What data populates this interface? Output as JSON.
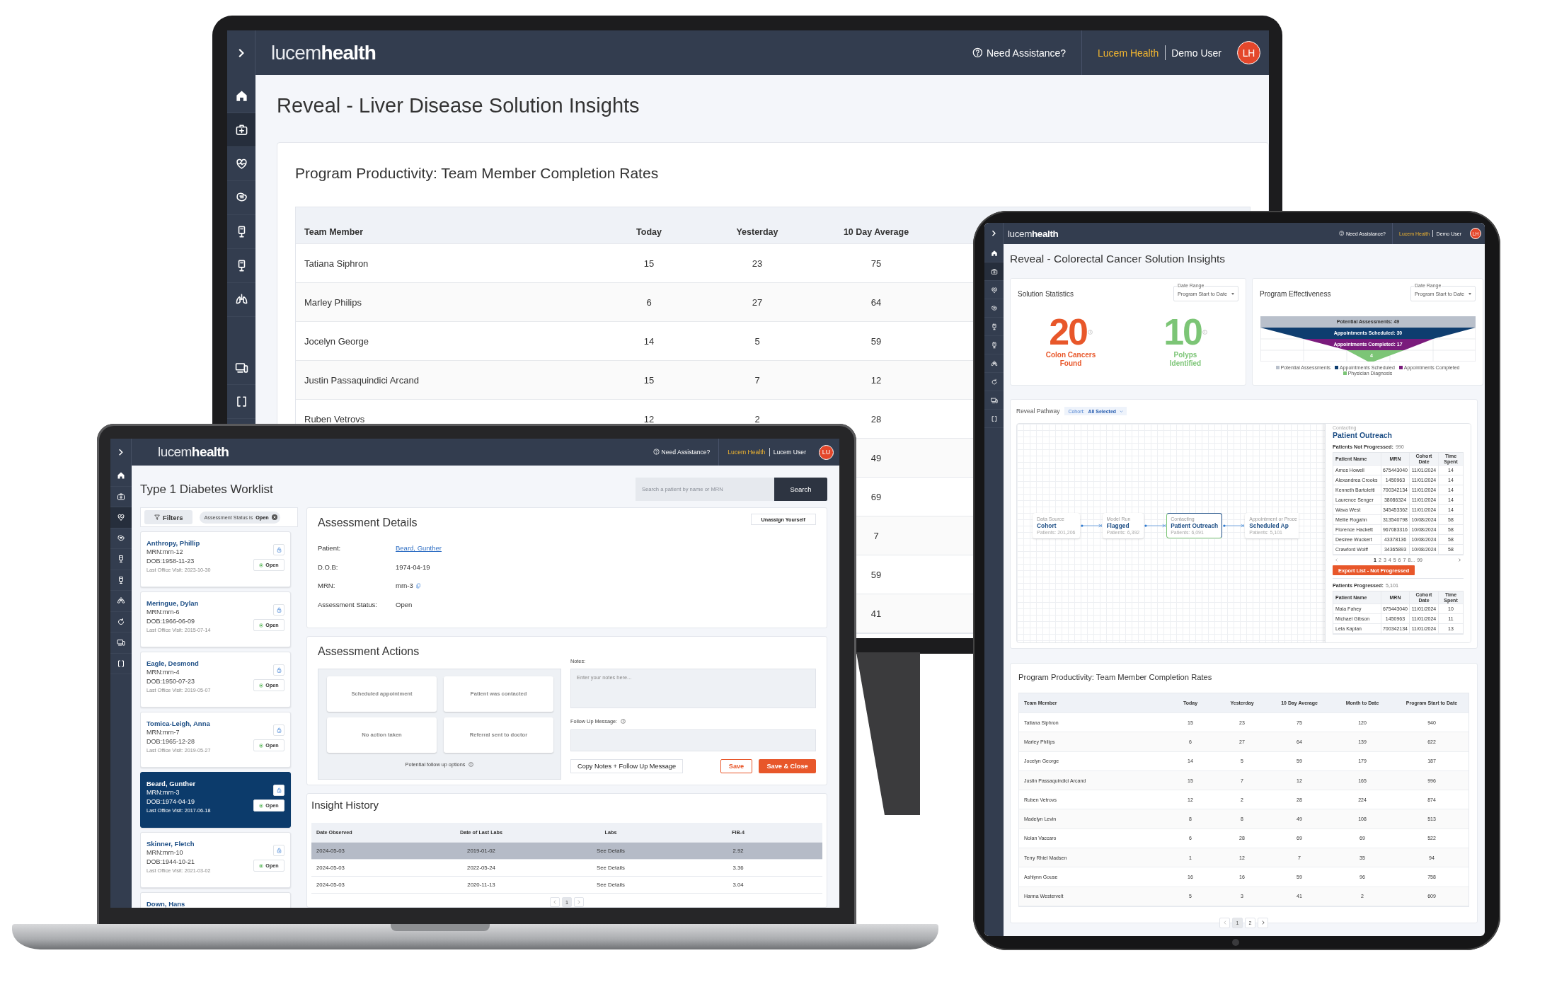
{
  "monitor": {
    "header": {
      "logo": "lucem**health**",
      "help": "Need Assistance?",
      "organization": "Lucem Health",
      "user": "Demo User",
      "avatar": "LH"
    },
    "sidebar": [
      {
        "kind": "home",
        "selected": false
      },
      {
        "kind": "medkit",
        "selected": true
      },
      {
        "kind": "heart",
        "selected": false
      },
      {
        "kind": "organ",
        "selected": false
      },
      {
        "kind": "kiosk",
        "selected": false
      },
      {
        "kind": "kiosk",
        "selected": false
      },
      {
        "kind": "lungs",
        "selected": false
      },
      {
        "kind": "blank"
      },
      {
        "kind": "devices",
        "selected": false
      },
      {
        "kind": "brackets",
        "selected": false
      }
    ],
    "title": "Reveal - Liver Disease Solution Insights",
    "productivity": {
      "title": "Program Productivity: Team Member Completion Rates",
      "columns": [
        "Team Member",
        "Today",
        "Yesterday",
        "10 Day Average"
      ],
      "rows": [
        {
          "name": "Tatiana Siphron",
          "today": "15",
          "yesterday": "23",
          "average": "75"
        },
        {
          "name": "Marley Philips",
          "today": "6",
          "yesterday": "27",
          "average": "64"
        },
        {
          "name": "Jocelyn George",
          "today": "14",
          "yesterday": "5",
          "average": "59"
        },
        {
          "name": "Justin Passaquindici Arcand",
          "today": "15",
          "yesterday": "7",
          "average": "12"
        },
        {
          "name": "Ruben Vetrovs",
          "today": "12",
          "yesterday": "2",
          "average": "28"
        },
        {
          "average": "49"
        },
        {
          "average": "69"
        },
        {
          "average": "7"
        },
        {
          "average": "59"
        },
        {
          "average": "41"
        }
      ]
    }
  },
  "laptop": {
    "header": {
      "logo": "lucem**health**",
      "help": "Need Assistance?",
      "organization": "Lucem Health",
      "user": "Lucem User",
      "avatar": "LU"
    },
    "sidebar": [
      {
        "kind": "home",
        "selected": false
      },
      {
        "kind": "medkit",
        "selected": false
      },
      {
        "kind": "heart",
        "selected": true
      },
      {
        "kind": "organ",
        "selected": false
      },
      {
        "kind": "kiosk",
        "selected": false
      },
      {
        "kind": "kiosk",
        "selected": false
      },
      {
        "kind": "lungs",
        "selected": false
      },
      {
        "kind": "refresh",
        "selected": false
      },
      {
        "kind": "devices",
        "selected": false
      },
      {
        "kind": "brackets",
        "selected": false
      }
    ],
    "title": "Type 1 Diabetes Worklist",
    "search": {
      "placeholder": "Search a patient by name or MRN",
      "button": "Search"
    },
    "filters": {
      "button": "Filters",
      "chip": "Assessment Status is **Open**"
    },
    "patients": [
      {
        "name": "Anthropy, Phillip",
        "mrn": "MRN:mrn-12",
        "dob": "DOB:1958-11-23",
        "last_visit": "Last Office Visit: 2023-10-30",
        "status": "Open",
        "selected": false
      },
      {
        "name": "Meringue, Dylan",
        "mrn": "MRN:mrn-6",
        "dob": "DOB:1966-06-09",
        "last_visit": "Last Office Visit: 2015-07-14",
        "status": "Open",
        "selected": false
      },
      {
        "name": "Eagle, Desmond",
        "mrn": "MRN:mrn-4",
        "dob": "DOB:1950-07-23",
        "last_visit": "Last Office Visit: 2019-05-07",
        "status": "Open",
        "selected": false
      },
      {
        "name": "Tomica-Leigh, Anna",
        "mrn": "MRN:mrn-7",
        "dob": "DOB:1965-12-28",
        "last_visit": "Last Office Visit: 2019-05-27",
        "status": "Open",
        "selected": false
      },
      {
        "name": "Beard, Gunther",
        "mrn": "MRN:mrn-3",
        "dob": "DOB:1974-04-19",
        "last_visit": "Last Office Visit: 2017-06-18",
        "status": "Open",
        "selected": true
      },
      {
        "name": "Skinner, Fletch",
        "mrn": "MRN:mrn-10",
        "dob": "DOB:1944-10-21",
        "last_visit": "Last Office Visit: 2021-03-02",
        "status": "Open",
        "selected": false
      },
      {
        "name": "Down, Hans",
        "selected": false
      }
    ],
    "details": {
      "title": "Assessment Details",
      "unassign": "Unassign Yourself",
      "fields": [
        {
          "label": "Patient:",
          "value": "Beard, Gunther",
          "kind": "link"
        },
        {
          "label": "D.O.B:",
          "value": "1974-04-19",
          "kind": "text"
        },
        {
          "label": "MRN:",
          "value": "mrn-3",
          "kind": "copy"
        },
        {
          "label": "Assessment Status:",
          "value": "Open",
          "kind": "text"
        }
      ]
    },
    "actions": {
      "title": "Assessment Actions",
      "options": [
        {
          "label": "Scheduled appointment",
          "selected": false
        },
        {
          "label": "Patient was contacted",
          "selected": false
        },
        {
          "label": "No action taken",
          "selected": false
        },
        {
          "label": "Referral sent to doctor",
          "selected": false
        }
      ],
      "options_note": "Potential follow up options",
      "notes_label": "Notes:",
      "notes_placeholder": "Enter your notes here...",
      "followup_label": "Follow Up Message:",
      "copy_button": "Copy Notes + Follow Up Message",
      "save_button": "Save",
      "save_close_button": "Save & Close"
    },
    "insight_history": {
      "title": "Insight History",
      "columns": [
        "Date Observed",
        "Date of Last Labs",
        "Labs",
        "FIB-4"
      ],
      "rows": [
        {
          "cells": [
            "2024-05-03",
            "2019-01-02",
            "See Details",
            "2.92"
          ],
          "selected": true
        },
        {
          "cells": [
            "2024-05-03",
            "2022-05-24",
            "See Details",
            "3.36"
          ],
          "selected": false
        },
        {
          "cells": [
            "2024-05-03",
            "2020-11-13",
            "See Details",
            "3.04"
          ],
          "selected": false
        }
      ],
      "pages": [
        {
          "label": "1",
          "selected": true
        }
      ]
    }
  },
  "tablet": {
    "header": {
      "logo": "lucem**health**",
      "help": "Need Assistance?",
      "organization": "Lucem Health",
      "user": "Demo User",
      "avatar": "LH"
    },
    "sidebar": [
      {
        "kind": "home",
        "selected": false
      },
      {
        "kind": "medkit",
        "selected": true
      },
      {
        "kind": "heart",
        "selected": false
      },
      {
        "kind": "organ",
        "selected": false
      },
      {
        "kind": "kiosk",
        "selected": false
      },
      {
        "kind": "kiosk",
        "selected": false
      },
      {
        "kind": "lungs",
        "selected": false
      },
      {
        "kind": "refresh",
        "selected": false
      },
      {
        "kind": "devices",
        "selected": false
      },
      {
        "kind": "brackets",
        "selected": false
      }
    ],
    "title": "Reveal - Colorectal Cancer Solution Insights",
    "statistics": {
      "title": "Solution Statistics",
      "date_range": {
        "label": "Date Range",
        "value": "Program Start to Date"
      },
      "metrics": [
        {
          "value": "20",
          "label": "Colon Cancers Found",
          "color": "#e8572a"
        },
        {
          "value": "10",
          "label": "Polyps Identified",
          "color": "#7cc576"
        }
      ]
    },
    "effectiveness": {
      "title": "Program Effectiveness",
      "date_range": {
        "label": "Date Range",
        "value": "Program Start to Date"
      },
      "stages": [
        {
          "label": "Potential Assessments: 49",
          "color": "#b9c0cb"
        },
        {
          "label": "Appointments Scheduled: 30",
          "color": "#0e3d6f"
        },
        {
          "label": "Appointments Completed: 17",
          "color": "#7a1b7c"
        },
        {
          "label": "4",
          "color": "#7cc576"
        }
      ],
      "legend": [
        {
          "label": "Potential Assessments",
          "color": "#b9c0cb"
        },
        {
          "label": "Appointments Scheduled",
          "color": "#0e3d6f"
        },
        {
          "label": "Appointments Completed",
          "color": "#7a1b7c"
        },
        {
          "label": "Physician Diagnosis",
          "color": "#7cc576"
        }
      ]
    },
    "pathway": {
      "title": "Reveal Pathway",
      "cohort": "Cohort: **All Selected**",
      "nodes": [
        {
          "category": "Data Source",
          "name": "Cohort",
          "count": "Patients: 201,206",
          "selected": false
        },
        {
          "category": "Model Run",
          "name": "Flagged",
          "count": "Patients: 6,392",
          "selected": false
        },
        {
          "category": "Contacting",
          "name": "Patient Outreach",
          "count": "Patients: 6,091",
          "selected": true
        },
        {
          "category": "Appointment or Proce",
          "name": "Scheduled Ap",
          "count": "Patients: 5,101",
          "selected": false
        }
      ],
      "panel": {
        "category": "Contacting",
        "title": "Patient Outreach",
        "not_progressed_label": "Patients Not Progressed:",
        "not_progressed_count": "990",
        "columns": [
          "Patient Name",
          "MRN",
          "Cohort Date",
          "Time Spent"
        ],
        "not_progressed_rows": [
          [
            "Amos Howell",
            "675443040",
            "11/01/2024",
            "14"
          ],
          [
            "Alexandrea Crooks",
            "1450963",
            "11/01/2024",
            "14"
          ],
          [
            "Kenneth Bartoletti",
            "700342134",
            "11/01/2024",
            "14"
          ],
          [
            "Laurence Senger",
            "38086324",
            "11/01/2024",
            "14"
          ],
          [
            "Wava West",
            "345453362",
            "11/01/2024",
            "14"
          ],
          [
            "Mellie Rogahn",
            "313540798",
            "10/08/2024",
            "58"
          ],
          [
            "Florence Hackett",
            "967083316",
            "10/08/2024",
            "58"
          ],
          [
            "Desiree Wuckert",
            "43378136",
            "10/08/2024",
            "58"
          ],
          [
            "Crawford Wolff",
            "34365893",
            "10/08/2024",
            "58"
          ]
        ],
        "pages": [
          {
            "label": "1",
            "selected": true
          },
          {
            "label": "2",
            "selected": false
          },
          {
            "label": "3",
            "selected": false
          },
          {
            "label": "4",
            "selected": false
          },
          {
            "label": "5",
            "selected": false
          },
          {
            "label": "6",
            "selected": false
          },
          {
            "label": "7",
            "selected": false
          },
          {
            "label": "8...",
            "selected": false
          },
          {
            "label": "99",
            "selected": false
          }
        ],
        "export_button": "Export List - Not Progressed",
        "progressed_label": "Patients Progressed:",
        "progressed_count": "5,101",
        "progressed_columns": [
          "Patient Name",
          "MRN",
          "Cohort Date",
          "Time Spent"
        ],
        "progressed_rows": [
          [
            "Mala Fahey",
            "675443040",
            "11/01/2024",
            "10"
          ],
          [
            "Michael Gibson",
            "1450963",
            "11/01/2024",
            "11"
          ],
          [
            "Lela Kaplan",
            "700342134",
            "11/01/2024",
            "13"
          ]
        ]
      }
    },
    "productivity": {
      "title": "Program Productivity: Team Member Completion Rates",
      "columns": [
        "Team Member",
        "Today",
        "Yesterday",
        "10 Day Average",
        "Month to Date",
        "Program Start to Date"
      ],
      "rows": [
        [
          "Tatiana Siphron",
          "15",
          "23",
          "75",
          "120",
          "940"
        ],
        [
          "Marley Philips",
          "6",
          "27",
          "64",
          "139",
          "622"
        ],
        [
          "Jocelyn George",
          "14",
          "5",
          "59",
          "179",
          "187"
        ],
        [
          "Justin Passaquindici Arcand",
          "15",
          "7",
          "12",
          "165",
          "996"
        ],
        [
          "Ruben Vetrovs",
          "12",
          "2",
          "28",
          "224",
          "874"
        ],
        [
          "Madelyn Levin",
          "8",
          "8",
          "49",
          "108",
          "513"
        ],
        [
          "Nolan Vaccaro",
          "6",
          "28",
          "69",
          "69",
          "522"
        ],
        [
          "Terry Rhiel Madsen",
          "1",
          "12",
          "7",
          "35",
          "94"
        ],
        [
          "Ashlynn Gouse",
          "16",
          "16",
          "59",
          "96",
          "758"
        ],
        [
          "Hanna Westervelt",
          "5",
          "3",
          "41",
          "2",
          "609"
        ]
      ],
      "pages": [
        {
          "label": "1",
          "selected": true
        },
        {
          "label": "2",
          "selected": false
        }
      ]
    }
  }
}
